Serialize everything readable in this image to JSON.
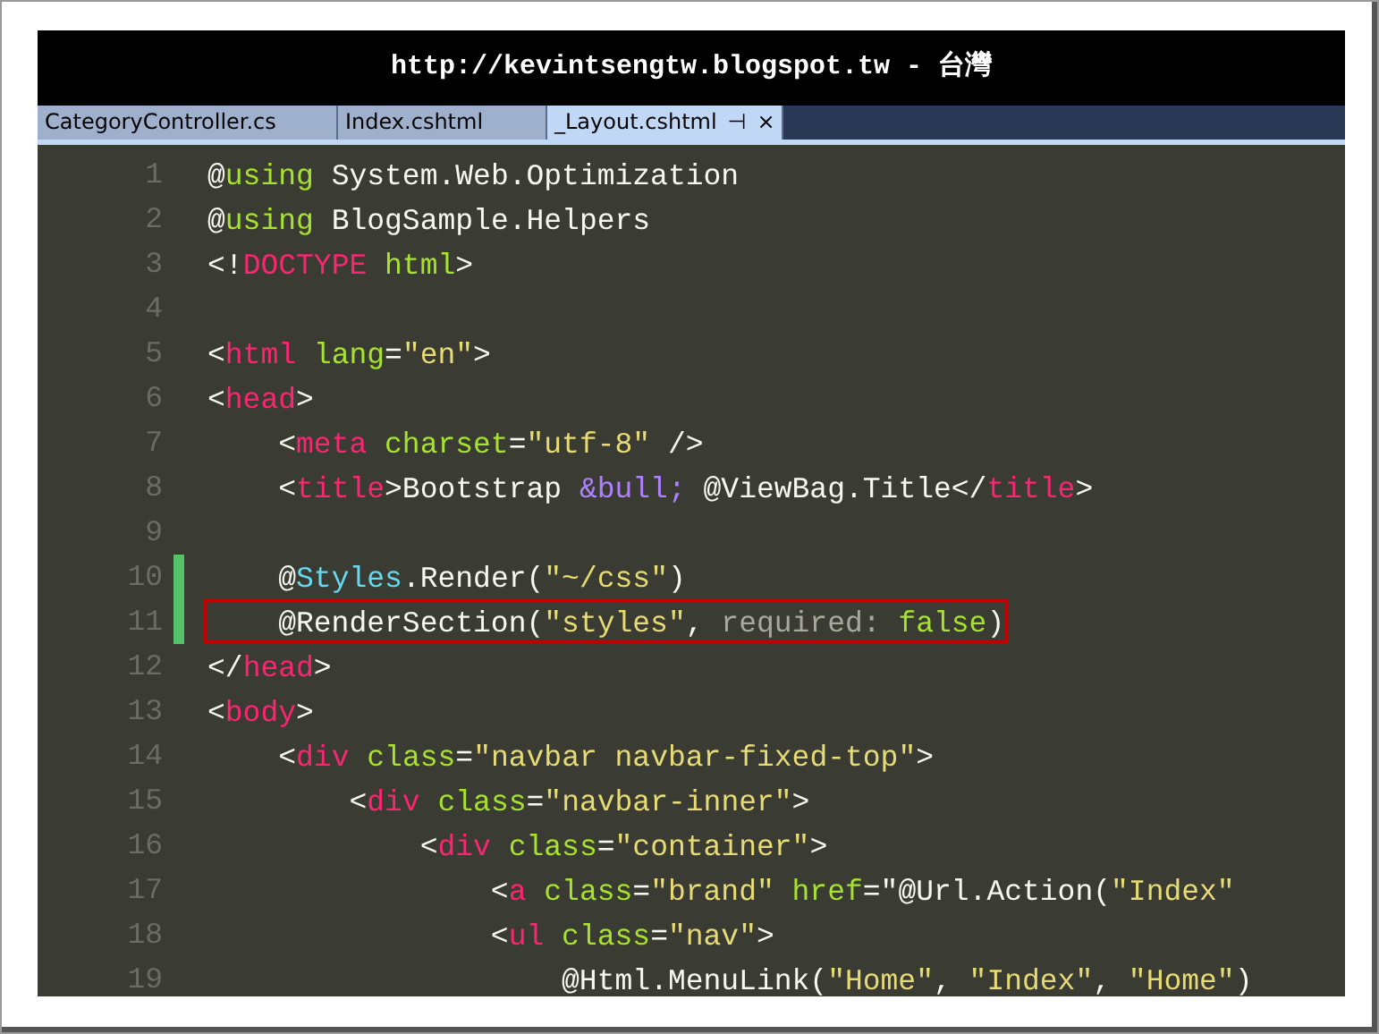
{
  "banner": {
    "title": "http://kevintsengtw.blogspot.tw - 台灣"
  },
  "tabs": [
    {
      "label": "CategoryController.cs",
      "selected": false
    },
    {
      "label": "Index.cshtml",
      "selected": false
    },
    {
      "label": "_Layout.cshtml",
      "selected": true,
      "pin": "⊣",
      "close": "×"
    }
  ],
  "editor": {
    "lines": [
      {
        "number": "1",
        "changed": false,
        "highlighted": false,
        "tokens": [
          {
            "kind": "plain",
            "text": "@"
          },
          {
            "kind": "attr",
            "text": "using"
          },
          {
            "kind": "plain",
            "text": " System.Web.Optimization"
          }
        ]
      },
      {
        "number": "2",
        "changed": false,
        "highlighted": false,
        "tokens": [
          {
            "kind": "plain",
            "text": "@"
          },
          {
            "kind": "attr",
            "text": "using"
          },
          {
            "kind": "plain",
            "text": " BlogSample.Helpers"
          }
        ]
      },
      {
        "number": "3",
        "changed": false,
        "highlighted": false,
        "tokens": [
          {
            "kind": "plain",
            "text": "<!"
          },
          {
            "kind": "tag",
            "text": "DOCTYPE"
          },
          {
            "kind": "attr",
            "text": " html"
          },
          {
            "kind": "plain",
            "text": ">"
          }
        ]
      },
      {
        "number": "4",
        "changed": false,
        "highlighted": false
      },
      {
        "number": "5",
        "changed": false,
        "highlighted": false,
        "tokens": [
          {
            "kind": "plain",
            "text": "<"
          },
          {
            "kind": "tag",
            "text": "html"
          },
          {
            "kind": "attr",
            "text": " lang"
          },
          {
            "kind": "plain",
            "text": "="
          },
          {
            "kind": "string",
            "text": "\"en\""
          },
          {
            "kind": "plain",
            "text": ">"
          }
        ]
      },
      {
        "number": "6",
        "changed": false,
        "highlighted": false,
        "tokens": [
          {
            "kind": "plain",
            "text": "<"
          },
          {
            "kind": "tag",
            "text": "head"
          },
          {
            "kind": "plain",
            "text": ">"
          }
        ]
      },
      {
        "number": "7",
        "changed": false,
        "highlighted": false,
        "tokens": [
          {
            "kind": "plain",
            "text": "    <"
          },
          {
            "kind": "tag",
            "text": "meta"
          },
          {
            "kind": "attr",
            "text": " charset"
          },
          {
            "kind": "plain",
            "text": "="
          },
          {
            "kind": "string",
            "text": "\"utf-8\""
          },
          {
            "kind": "plain",
            "text": " />"
          }
        ]
      },
      {
        "number": "8",
        "changed": false,
        "highlighted": false,
        "tokens": [
          {
            "kind": "plain",
            "text": "    <"
          },
          {
            "kind": "tag",
            "text": "title"
          },
          {
            "kind": "plain",
            "text": ">Bootstrap "
          },
          {
            "kind": "entity",
            "text": "&bull;"
          },
          {
            "kind": "plain",
            "text": " @ViewBag.Title</"
          },
          {
            "kind": "tag",
            "text": "title"
          },
          {
            "kind": "plain",
            "text": ">"
          }
        ]
      },
      {
        "number": "9",
        "changed": false,
        "highlighted": false
      },
      {
        "number": "10",
        "changed": true,
        "highlighted": false,
        "tokens": [
          {
            "kind": "plain",
            "text": "    @"
          },
          {
            "kind": "type",
            "text": "Styles"
          },
          {
            "kind": "plain",
            "text": ".Render("
          },
          {
            "kind": "string",
            "text": "\"~/css\""
          },
          {
            "kind": "plain",
            "text": ")"
          }
        ]
      },
      {
        "number": "11",
        "changed": true,
        "highlighted": true,
        "tokens": [
          {
            "kind": "plain",
            "text": "    @RenderSection("
          },
          {
            "kind": "string",
            "text": "\"styles\""
          },
          {
            "kind": "plain",
            "text": ", "
          },
          {
            "kind": "param",
            "text": "required:"
          },
          {
            "kind": "attr",
            "text": " false"
          },
          {
            "kind": "plain",
            "text": ")"
          }
        ]
      },
      {
        "number": "12",
        "changed": false,
        "highlighted": false,
        "tokens": [
          {
            "kind": "plain",
            "text": "</"
          },
          {
            "kind": "tag",
            "text": "head"
          },
          {
            "kind": "plain",
            "text": ">"
          }
        ]
      },
      {
        "number": "13",
        "changed": false,
        "highlighted": false,
        "tokens": [
          {
            "kind": "plain",
            "text": "<"
          },
          {
            "kind": "tag",
            "text": "body"
          },
          {
            "kind": "plain",
            "text": ">"
          }
        ]
      },
      {
        "number": "14",
        "changed": false,
        "highlighted": false,
        "tokens": [
          {
            "kind": "plain",
            "text": "    <"
          },
          {
            "kind": "tag",
            "text": "div"
          },
          {
            "kind": "attr",
            "text": " class"
          },
          {
            "kind": "plain",
            "text": "="
          },
          {
            "kind": "string",
            "text": "\"navbar navbar-fixed-top\""
          },
          {
            "kind": "plain",
            "text": ">"
          }
        ]
      },
      {
        "number": "15",
        "changed": false,
        "highlighted": false,
        "tokens": [
          {
            "kind": "plain",
            "text": "        <"
          },
          {
            "kind": "tag",
            "text": "div"
          },
          {
            "kind": "attr",
            "text": " class"
          },
          {
            "kind": "plain",
            "text": "="
          },
          {
            "kind": "string",
            "text": "\"navbar-inner\""
          },
          {
            "kind": "plain",
            "text": ">"
          }
        ]
      },
      {
        "number": "16",
        "changed": false,
        "highlighted": false,
        "tokens": [
          {
            "kind": "plain",
            "text": "            <"
          },
          {
            "kind": "tag",
            "text": "div"
          },
          {
            "kind": "attr",
            "text": " class"
          },
          {
            "kind": "plain",
            "text": "="
          },
          {
            "kind": "string",
            "text": "\"container\""
          },
          {
            "kind": "plain",
            "text": ">"
          }
        ]
      },
      {
        "number": "17",
        "changed": false,
        "highlighted": false,
        "tokens": [
          {
            "kind": "plain",
            "text": "                <"
          },
          {
            "kind": "tag",
            "text": "a"
          },
          {
            "kind": "attr",
            "text": " class"
          },
          {
            "kind": "plain",
            "text": "="
          },
          {
            "kind": "string",
            "text": "\"brand\""
          },
          {
            "kind": "attr",
            "text": " href"
          },
          {
            "kind": "plain",
            "text": "=\"@Url.Action("
          },
          {
            "kind": "string",
            "text": "\"Index\""
          }
        ]
      },
      {
        "number": "18",
        "changed": false,
        "highlighted": false,
        "tokens": [
          {
            "kind": "plain",
            "text": "                <"
          },
          {
            "kind": "tag",
            "text": "ul"
          },
          {
            "kind": "attr",
            "text": " class"
          },
          {
            "kind": "plain",
            "text": "="
          },
          {
            "kind": "string",
            "text": "\"nav\""
          },
          {
            "kind": "plain",
            "text": ">"
          }
        ]
      },
      {
        "number": "19",
        "changed": false,
        "highlighted": false,
        "tokens": [
          {
            "kind": "plain",
            "text": "                    @Html.MenuLink("
          },
          {
            "kind": "string",
            "text": "\"Home\""
          },
          {
            "kind": "plain",
            "text": ", "
          },
          {
            "kind": "string",
            "text": "\"Index\""
          },
          {
            "kind": "plain",
            "text": ", "
          },
          {
            "kind": "string",
            "text": "\"Home\""
          },
          {
            "kind": "plain",
            "text": ")"
          }
        ]
      }
    ]
  }
}
